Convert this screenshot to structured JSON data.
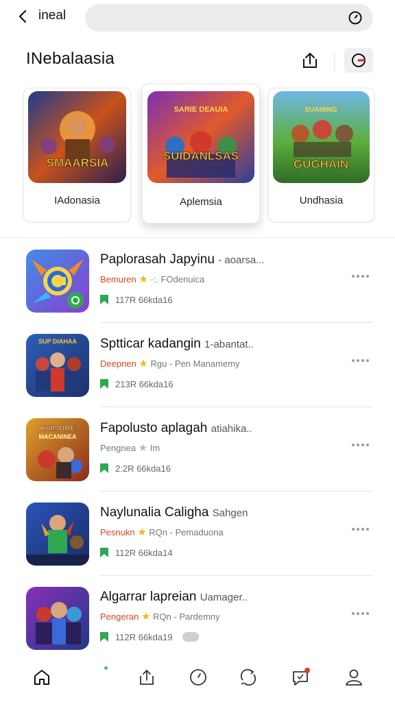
{
  "topbar": {
    "back_label": "ineal",
    "search_placeholder": ""
  },
  "header": {
    "title": "INebalaasia"
  },
  "featured": [
    {
      "label": "IAdonasia",
      "art_title": "SMAARSIA"
    },
    {
      "label": "Aplemsia",
      "art_title": "SUIDANLSAS"
    },
    {
      "label": "Undhasia",
      "art_title": "GUGHAIN"
    }
  ],
  "list": [
    {
      "title": "Paplorasah Japyinu",
      "title_suffix": "- aoarsa...",
      "developer": "Bemuren",
      "rating_text": "·:. FOdenuica",
      "star_gray": false,
      "stat": "117R 66kda16",
      "toggle": false
    },
    {
      "title": "Sptticar kadangin",
      "title_suffix": "1-abantat..",
      "developer": "Deepnen",
      "rating_text": "Rgu - Pen Manamemy",
      "star_gray": false,
      "stat": "213R 66kda16",
      "toggle": false
    },
    {
      "title": "Fapolusto aplagah",
      "title_suffix": "atiahika..",
      "developer": "Pengnea",
      "rating_text": "Im",
      "star_gray": true,
      "stat": "2:2R 66kda16",
      "toggle": false
    },
    {
      "title": "Naylunalia Caligha",
      "title_suffix": "Sahgen",
      "developer": "Pesnukn",
      "rating_text": "RQn - Pemaduona",
      "star_gray": false,
      "stat": "112R 66kda14",
      "toggle": false
    },
    {
      "title": "Algarrar lapreian",
      "title_suffix": "Uamager..",
      "developer": "Pengeran",
      "rating_text": "RQn - Pardemny",
      "star_gray": false,
      "stat": "112R 66kda19",
      "toggle": true
    }
  ],
  "nav": {
    "items": [
      "home-icon",
      "share-icon",
      "clock-icon",
      "refresh-chat-icon",
      "chat-icon",
      "profile-icon"
    ]
  },
  "colors": {
    "accent_orange": "#d4481f",
    "star": "#f3b51b",
    "flag_green": "#2fa84f",
    "badge_red": "#e53935"
  }
}
